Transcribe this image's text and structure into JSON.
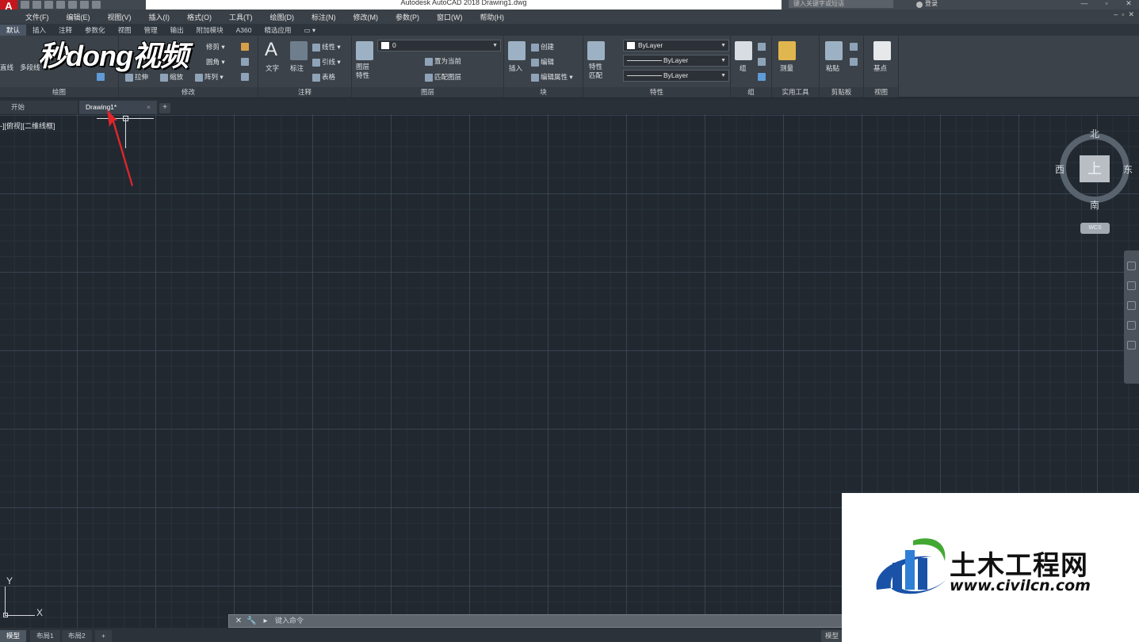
{
  "window": {
    "title": "Autodesk AutoCAD 2018    Drawing1.dwg",
    "app_letter": "A",
    "search_placeholder": "键入关键字或短语",
    "login": "登录"
  },
  "menu": [
    "文件(F)",
    "编辑(E)",
    "视图(V)",
    "插入(I)",
    "格式(O)",
    "工具(T)",
    "绘图(D)",
    "标注(N)",
    "修改(M)",
    "参数(P)",
    "窗口(W)",
    "帮助(H)"
  ],
  "ribbon_tabs": [
    "默认",
    "插入",
    "注释",
    "参数化",
    "视图",
    "管理",
    "输出",
    "附加模块",
    "A360",
    "精选应用"
  ],
  "ribbon": {
    "draw": {
      "title": "绘图",
      "line": "直线",
      "polyline": "多段线"
    },
    "modify": {
      "title": "修改",
      "trim": "修剪",
      "fillet": "圆角",
      "array": "阵列",
      "stretch": "拉伸",
      "scale": "缩放"
    },
    "annotation": {
      "title": "注释",
      "text": "文字",
      "dimension": "标注",
      "linear": "线性",
      "leader": "引线",
      "table": "表格"
    },
    "layers": {
      "title": "图层",
      "layer_props": "图层\n特性",
      "current_layer": "0",
      "set_current": "置为当前",
      "match_layer": "匹配图层"
    },
    "block": {
      "title": "块",
      "insert": "插入",
      "create": "创建",
      "edit": "编辑",
      "edit_attr": "编辑属性"
    },
    "properties": {
      "title": "特性",
      "match": "特性\n匹配",
      "color": "ByLayer",
      "linetype": "ByLayer",
      "lineweight": "ByLayer"
    },
    "groups": {
      "title": "组",
      "group": "组"
    },
    "utilities": {
      "title": "实用工具",
      "measure": "测量"
    },
    "clipboard": {
      "title": "剪贴板",
      "paste": "粘贴"
    },
    "view": {
      "title": "视图",
      "base": "基点"
    }
  },
  "watermark": "秒dong视频",
  "doc_tabs": {
    "start": "开始",
    "drawing": "Drawing1*"
  },
  "viewport_label": "-][俯视][二维线框]",
  "viewcube": {
    "face": "上",
    "north": "北",
    "south": "南",
    "east": "东",
    "west": "西",
    "wcs": "WCS"
  },
  "ucs": {
    "x": "X",
    "y": "Y"
  },
  "command_line": {
    "placeholder": "键入命令"
  },
  "layout_tabs": [
    "模型",
    "布局1",
    "布局2"
  ],
  "model_button": "模型",
  "site_logo": {
    "main": "土木工程网",
    "url": "www.civilcn.com"
  },
  "colors": {
    "accent_red": "#e0262c",
    "canvas": "#212830",
    "logo_blue": "#1a52a8",
    "logo_green": "#43a832"
  }
}
